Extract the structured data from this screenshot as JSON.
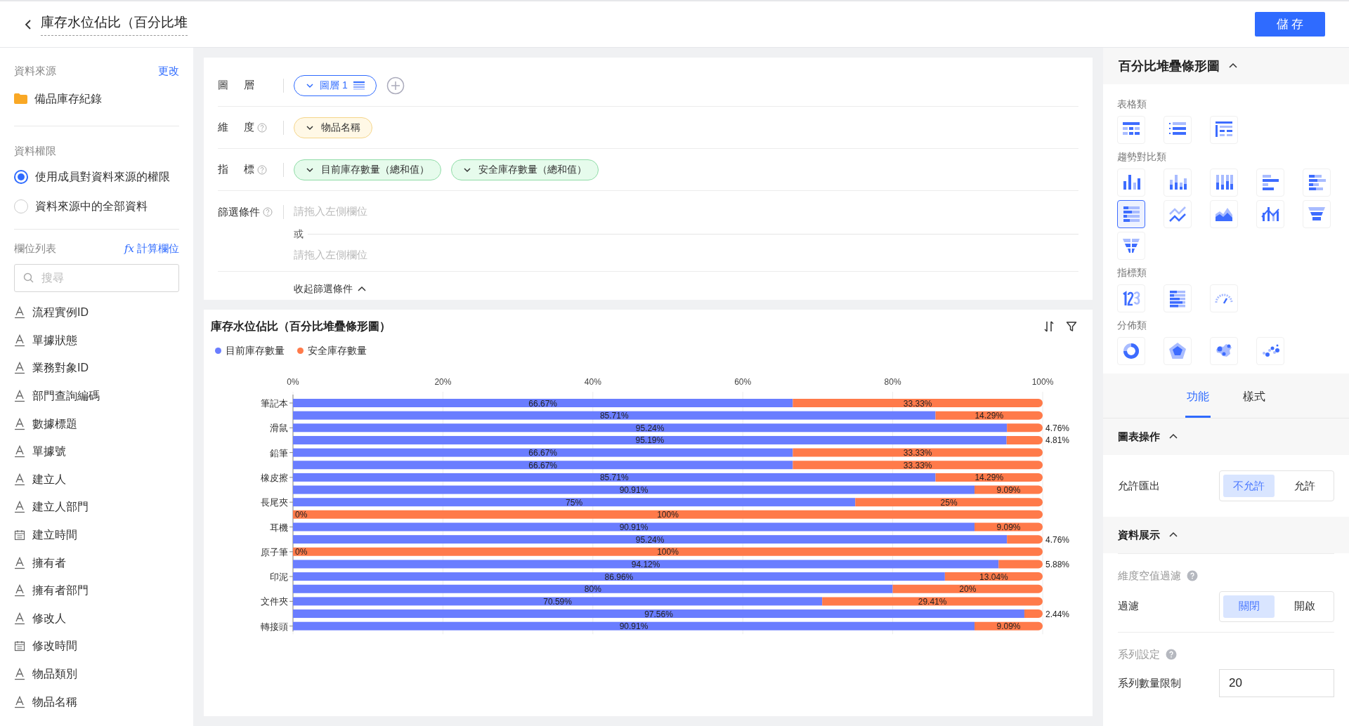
{
  "header": {
    "title": "庫存水位佔比（百分比堆",
    "save_button": "儲 存"
  },
  "sidebar": {
    "data_source": {
      "heading": "資料來源",
      "change_link": "更改",
      "source": "備品庫存紀錄"
    },
    "permissions": {
      "heading": "資料權限",
      "options": [
        {
          "label": "使用成員對資料來源的權限",
          "selected": true
        },
        {
          "label": "資料來源中的全部資料",
          "selected": false
        }
      ]
    },
    "fields": {
      "heading": "欄位列表",
      "calc_icon": "fx",
      "calc_link": "計算欄位",
      "search_placeholder": "搜尋",
      "items": [
        {
          "label": "流程實例ID",
          "kind": "text"
        },
        {
          "label": "單據狀態",
          "kind": "text"
        },
        {
          "label": "業務對象ID",
          "kind": "text"
        },
        {
          "label": "部門查詢編碼",
          "kind": "text"
        },
        {
          "label": "數據標題",
          "kind": "text"
        },
        {
          "label": "單據號",
          "kind": "text"
        },
        {
          "label": "建立人",
          "kind": "text"
        },
        {
          "label": "建立人部門",
          "kind": "text"
        },
        {
          "label": "建立時間",
          "kind": "date"
        },
        {
          "label": "擁有者",
          "kind": "text"
        },
        {
          "label": "擁有者部門",
          "kind": "text"
        },
        {
          "label": "修改人",
          "kind": "text"
        },
        {
          "label": "修改時間",
          "kind": "date"
        },
        {
          "label": "物品類別",
          "kind": "text"
        },
        {
          "label": "物品名稱",
          "kind": "text"
        }
      ]
    }
  },
  "config": {
    "layer": {
      "label": "圖層",
      "chip": "圖層 1"
    },
    "dimension": {
      "label": "維度",
      "chips": [
        "物品名稱"
      ]
    },
    "metrics": {
      "label": "指標",
      "chips": [
        "目前庫存數量（總和值）",
        "安全庫存數量（總和值）"
      ]
    },
    "filters": {
      "label": "篩選條件",
      "placeholders": [
        "請拖入左側欄位",
        "請拖入左側欄位"
      ],
      "separator": "或",
      "collapse": "收起篩選條件"
    }
  },
  "chart": {
    "title": "庫存水位佔比（百分比堆疊條形圖）",
    "chart_data": {
      "type": "bar",
      "orientation": "horizontal",
      "stacked": true,
      "grid": true,
      "categories": [
        "筆記本",
        null,
        "滑鼠",
        null,
        "鉛筆",
        null,
        "橡皮擦",
        null,
        "長尾夾",
        null,
        "耳機",
        null,
        "原子筆",
        null,
        "印泥",
        null,
        "文件夾",
        null,
        "轉接頭"
      ],
      "xlim": [
        0,
        100
      ],
      "xticks": [
        {
          "value": 0,
          "label": "0%"
        },
        {
          "value": 20,
          "label": "20%"
        },
        {
          "value": 40,
          "label": "40%"
        },
        {
          "value": 60,
          "label": "60%"
        },
        {
          "value": 80,
          "label": "80%"
        },
        {
          "value": 100,
          "label": "100%"
        }
      ],
      "series": [
        {
          "name": "目前庫存數量",
          "color": "#6a7dff",
          "values": [
            66.67,
            85.71,
            95.24,
            95.19,
            66.67,
            66.67,
            85.71,
            90.91,
            75,
            0,
            90.91,
            95.24,
            0,
            94.12,
            86.96,
            80,
            70.59,
            97.56,
            90.91
          ]
        },
        {
          "name": "安全庫存數量",
          "color": "#ff7a4a",
          "values": [
            33.33,
            14.29,
            4.76,
            4.81,
            33.33,
            33.33,
            14.29,
            9.09,
            25,
            100,
            9.09,
            4.76,
            100,
            5.88,
            13.04,
            20,
            29.41,
            2.44,
            9.09
          ]
        }
      ],
      "value_labels": [
        [
          "66.67%",
          "85.71%",
          "95.24%",
          "95.19%",
          "66.67%",
          "66.67%",
          "85.71%",
          "90.91%",
          "75%",
          "0%",
          "90.91%",
          "95.24%",
          "0%",
          "94.12%",
          "86.96%",
          "80%",
          "70.59%",
          "97.56%",
          "90.91%"
        ],
        [
          "33.33%",
          "14.29%",
          "4.76%",
          "4.81%",
          "33.33%",
          "33.33%",
          "14.29%",
          "9.09%",
          "25%",
          "100%",
          "9.09%",
          "4.76%",
          "100%",
          "5.88%",
          "13.04%",
          "20%",
          "29.41%",
          "2.44%",
          "9.09%"
        ]
      ]
    }
  },
  "right_panel": {
    "chart_name": "百分比堆疊條形圖",
    "groups": [
      {
        "heading": "表格類",
        "items": [
          {
            "kind": "table",
            "selected": false
          },
          {
            "kind": "list",
            "selected": false
          },
          {
            "kind": "pivot",
            "selected": false
          }
        ]
      },
      {
        "heading": "趨勢對比類",
        "items": [
          {
            "kind": "column",
            "selected": false
          },
          {
            "kind": "stacked-column",
            "selected": false
          },
          {
            "kind": "percent-column",
            "selected": false
          },
          {
            "kind": "bar",
            "selected": false
          },
          {
            "kind": "stacked-bar",
            "selected": false
          },
          {
            "kind": "percent-bar",
            "selected": true
          },
          {
            "kind": "line",
            "selected": false
          },
          {
            "kind": "area",
            "selected": false
          },
          {
            "kind": "combo",
            "selected": false
          },
          {
            "kind": "funnel",
            "selected": false
          },
          {
            "kind": "compare-funnel",
            "selected": false
          }
        ]
      },
      {
        "heading": "指標類",
        "items": [
          {
            "kind": "kpi",
            "selected": false
          },
          {
            "kind": "ranking",
            "selected": false
          },
          {
            "kind": "gauge",
            "selected": false
          }
        ]
      },
      {
        "heading": "分佈類",
        "items": [
          {
            "kind": "donut",
            "selected": false
          },
          {
            "kind": "radar",
            "selected": false
          },
          {
            "kind": "map",
            "selected": false
          },
          {
            "kind": "scatter",
            "selected": false
          }
        ]
      }
    ],
    "tabs": [
      {
        "label": "功能",
        "selected": true
      },
      {
        "label": "樣式",
        "selected": false
      }
    ],
    "sections": [
      {
        "heading": "圖表操作",
        "settings": [
          {
            "kind": "toggle",
            "label": "允許匯出",
            "options": [
              {
                "label": "不允許",
                "selected": true
              },
              {
                "label": "允許",
                "selected": false
              }
            ]
          }
        ]
      },
      {
        "heading": "資料展示",
        "settings": [
          {
            "kind": "subheading",
            "label": "維度空值過濾"
          },
          {
            "kind": "toggle",
            "label": "過濾",
            "options": [
              {
                "label": "關閉",
                "selected": true
              },
              {
                "label": "開啟",
                "selected": false
              }
            ]
          },
          {
            "kind": "subheading",
            "label": "系列設定"
          },
          {
            "kind": "number",
            "label": "系列數量限制",
            "value": "20"
          }
        ]
      }
    ]
  }
}
